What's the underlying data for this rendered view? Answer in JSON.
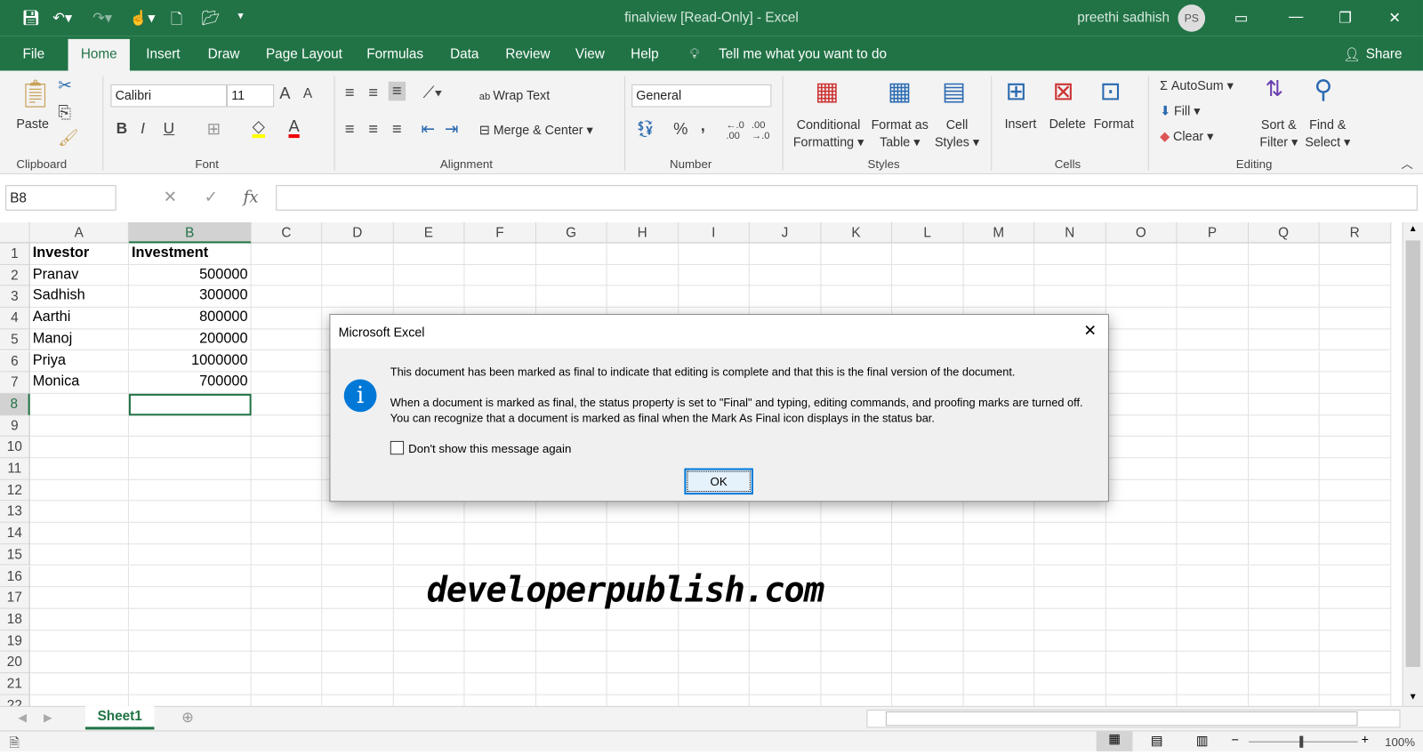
{
  "window": {
    "title": "finalview  [Read-Only]  -  Excel",
    "user": "preethi sadhish",
    "avatar": "PS"
  },
  "tabs": [
    "File",
    "Home",
    "Insert",
    "Draw",
    "Page Layout",
    "Formulas",
    "Data",
    "Review",
    "View",
    "Help"
  ],
  "tell_me": "Tell me what you want to do",
  "share": "Share",
  "ribbon": {
    "clipboard": {
      "group": "Clipboard",
      "paste": "Paste"
    },
    "font": {
      "group": "Font",
      "name": "Calibri",
      "size": "11",
      "bold": "B",
      "italic": "I",
      "underline": "U"
    },
    "alignment": {
      "group": "Alignment",
      "wrap": "Wrap Text",
      "merge": "Merge & Center"
    },
    "number": {
      "group": "Number",
      "format": "General",
      "percent": "%",
      "comma": ","
    },
    "styles": {
      "group": "Styles",
      "conditional": [
        "Conditional",
        "Formatting"
      ],
      "format_table": [
        "Format as",
        "Table"
      ],
      "cell_styles": [
        "Cell",
        "Styles"
      ]
    },
    "cells": {
      "group": "Cells",
      "insert": "Insert",
      "delete": "Delete",
      "format": "Format"
    },
    "editing": {
      "group": "Editing",
      "autosum": "AutoSum",
      "fill": "Fill",
      "clear": "Clear",
      "sort": [
        "Sort &",
        "Filter"
      ],
      "find": [
        "Find &",
        "Select"
      ]
    }
  },
  "formula_bar": {
    "name_box": "B8",
    "fx": "fx",
    "value": ""
  },
  "grid": {
    "columns": [
      "A",
      "B",
      "C",
      "D",
      "E",
      "F",
      "G",
      "H",
      "I",
      "J",
      "K",
      "L",
      "M",
      "N",
      "O",
      "P",
      "Q",
      "R"
    ],
    "row_count": 22,
    "selected": "B8",
    "rows": [
      [
        "Investor",
        "Investment"
      ],
      [
        "Pranav",
        "500000"
      ],
      [
        "Sadhish",
        "300000"
      ],
      [
        "Aarthi",
        "800000"
      ],
      [
        "Manoj",
        "200000"
      ],
      [
        "Priya",
        "1000000"
      ],
      [
        "Monica",
        "700000"
      ]
    ]
  },
  "sheets": [
    "Sheet1"
  ],
  "status": {
    "zoom": "100%"
  },
  "dialog": {
    "title": "Microsoft Excel",
    "line1": "This document has been marked as final to indicate that editing is complete and that this is the final version of the document.",
    "line2": "When a document is marked as final, the status property is set to \"Final\" and typing, editing commands, and proofing marks are turned off.",
    "line3": "You can recognize that a document is marked as final when the Mark As Final icon displays in the status bar.",
    "checkbox": "Don't show this message again",
    "checked": false,
    "ok": "OK"
  },
  "watermark": "developerpublish.com",
  "colors": {
    "brand": "#217346",
    "info": "#0078d7"
  }
}
